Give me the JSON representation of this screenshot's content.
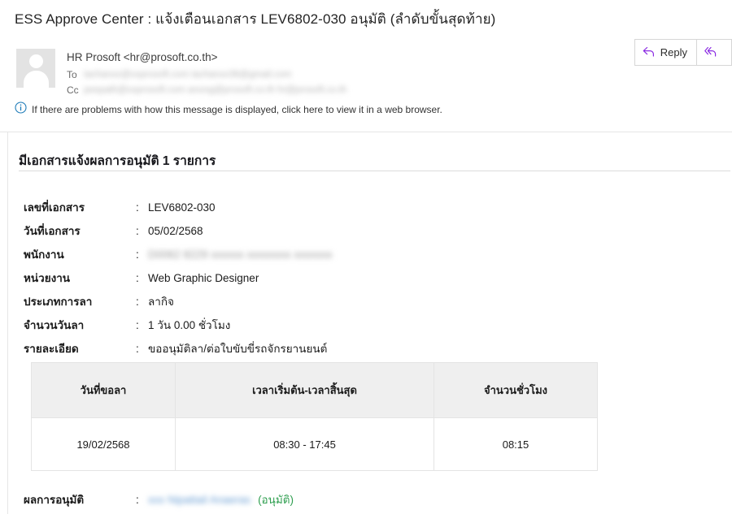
{
  "subject": "ESS Approve Center : แจ้งเตือนเอกสาร LEV6802-030 อนุมัติ (ลำดับขั้นสุดท้าย)",
  "toolbar": {
    "reply_label": "Reply",
    "reply_all_label": "",
    "reply_icon": "reply-arrow-icon",
    "reply_all_icon": "reply-all-arrow-icon",
    "accent_color": "#8a2be2"
  },
  "sender": {
    "name_line": "HR Prosoft <hr@prosoft.co.th>",
    "avatar_icon": "person-placeholder-icon",
    "to_label": "To",
    "to_value": "tachanxx@xxprosoft.com  tachanxx36@gmail.com",
    "cc_label": "Cc",
    "cc_value": "peepath@xxprosoft.com  anong@prosoft.co.th  hr@prosoft.co.th"
  },
  "info_bar": {
    "icon": "info-circle-icon",
    "text": "If there are problems with how this message is displayed, click here to view it in a web browser."
  },
  "document": {
    "heading": "มีเอกสารแจ้งผลการอนุมัติ 1 รายการ",
    "colon": ":",
    "fields": [
      {
        "label": "เลขที่เอกสาร",
        "value": "LEV6802-030",
        "blurred": false
      },
      {
        "label": "วันที่เอกสาร",
        "value": "05/02/2568",
        "blurred": false
      },
      {
        "label": "พนักงาน",
        "value": "D0062 8229 xxxxxx xxxxxxxx xxxxxxx",
        "blurred": true
      },
      {
        "label": "หน่วยงาน",
        "value": "Web Graphic Designer",
        "blurred": false
      },
      {
        "label": "ประเภทการลา",
        "value": "ลากิจ",
        "blurred": false
      },
      {
        "label": "จำนวนวันลา",
        "value": "1 วัน 0.00 ชั่วโมง",
        "blurred": false
      },
      {
        "label": "รายละเอียด",
        "value": "ขออนุมัติลา/ต่อใบขับขี่รถจักรยานยนต์",
        "blurred": false
      }
    ],
    "table": {
      "headers": [
        "วันที่ขอลา",
        "เวลาเริ่มต้น-เวลาสิ้นสุด",
        "จำนวนชั่วโมง"
      ],
      "rows": [
        [
          "19/02/2568",
          "08:30 - 17:45",
          "08:15"
        ]
      ]
    },
    "result": {
      "label": "ผลการอนุมัติ",
      "approver_name": "xxx Nipattail Anaeras",
      "status": "(อนุมัติ)",
      "status_color": "#2e9e4f"
    }
  }
}
